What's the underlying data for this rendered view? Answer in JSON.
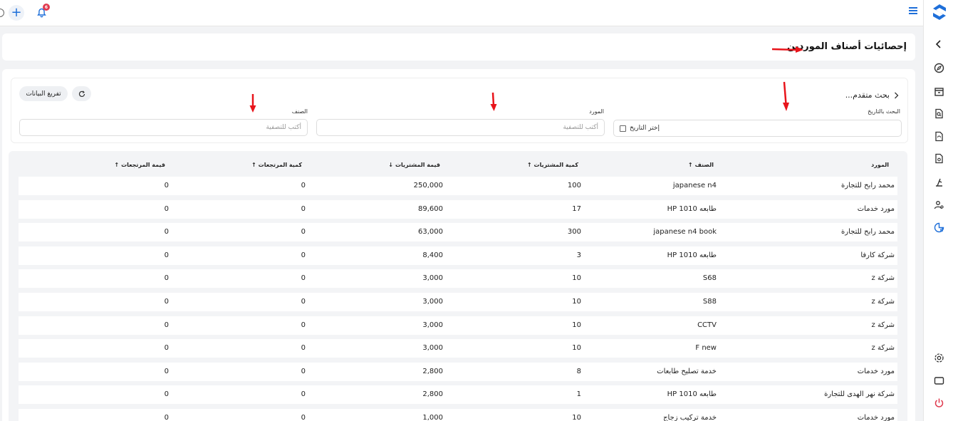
{
  "topbar": {
    "notification_count": "6"
  },
  "page": {
    "title": "إحصائيات أصناف الموردين"
  },
  "filters": {
    "advanced_search": "بحث متقدم...",
    "clear_button": "تفريغ البيانات",
    "date_label": "البحث بالتاريخ",
    "date_value": "إختر التاريخ",
    "supplier_label": "المورد",
    "supplier_placeholder": "أكتب للتصفية",
    "item_label": "الصنف",
    "item_placeholder": "أكتب للتصفية"
  },
  "table": {
    "headers": {
      "supplier": "المورد",
      "item": "الصنف",
      "purchase_qty": "كمية المشتريات",
      "purchase_value": "قيمة المشتريات",
      "return_qty": "كمية المرتجعات",
      "return_value": "قيمة المرتجعات"
    },
    "rows": [
      {
        "supplier": "محمد رابح للتجارة",
        "item": "japanese n4",
        "purchase_qty": "100",
        "purchase_value": "250,000",
        "return_qty": "0",
        "return_value": "0"
      },
      {
        "supplier": "مورد خدمات",
        "item": "طابعه HP 1010",
        "purchase_qty": "17",
        "purchase_value": "89,600",
        "return_qty": "0",
        "return_value": "0"
      },
      {
        "supplier": "محمد رابح للتجارة",
        "item": "japanese n4 book",
        "purchase_qty": "300",
        "purchase_value": "63,000",
        "return_qty": "0",
        "return_value": "0"
      },
      {
        "supplier": "شركة كارفا",
        "item": "طابعه HP 1010",
        "purchase_qty": "3",
        "purchase_value": "8,400",
        "return_qty": "0",
        "return_value": "0"
      },
      {
        "supplier": "شركة z",
        "item": "S68",
        "purchase_qty": "10",
        "purchase_value": "3,000",
        "return_qty": "0",
        "return_value": "0"
      },
      {
        "supplier": "شركة z",
        "item": "S88",
        "purchase_qty": "10",
        "purchase_value": "3,000",
        "return_qty": "0",
        "return_value": "0"
      },
      {
        "supplier": "شركة z",
        "item": "CCTV",
        "purchase_qty": "10",
        "purchase_value": "3,000",
        "return_qty": "0",
        "return_value": "0"
      },
      {
        "supplier": "شركة z",
        "item": "F new",
        "purchase_qty": "10",
        "purchase_value": "3,000",
        "return_qty": "0",
        "return_value": "0"
      },
      {
        "supplier": "مورد خدمات",
        "item": "خدمة تصليح طابعات",
        "purchase_qty": "8",
        "purchase_value": "2,800",
        "return_qty": "0",
        "return_value": "0"
      },
      {
        "supplier": "شركة  نهر الهدى للتجارة",
        "item": "طابعه HP 1010",
        "purchase_qty": "1",
        "purchase_value": "2,800",
        "return_qty": "0",
        "return_value": "0"
      },
      {
        "supplier": "مورد خدمات",
        "item": "خدمة تركيب زجاج",
        "purchase_qty": "10",
        "purchase_value": "1,000",
        "return_qty": "0",
        "return_value": "0"
      }
    ]
  },
  "colors": {
    "accent": "#1e6fd9",
    "badge": "#e03a4e",
    "annotation_arrow": "#e8141b"
  }
}
